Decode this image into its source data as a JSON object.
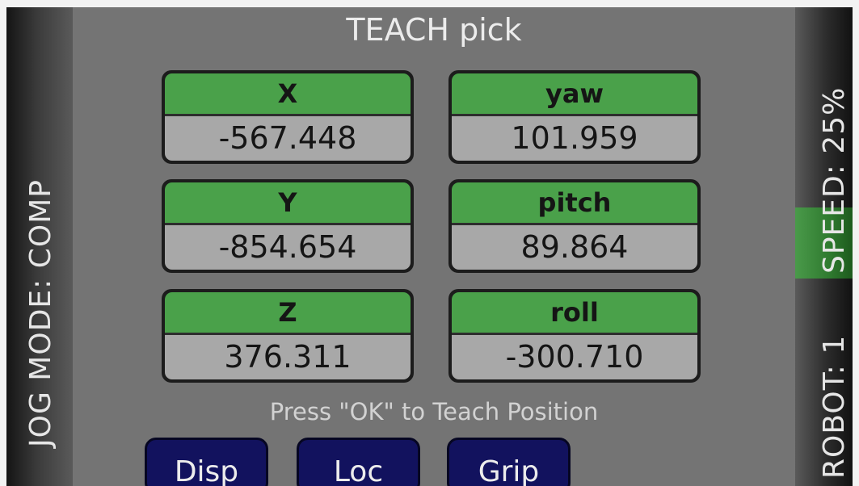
{
  "title": "TEACH pick",
  "jog_mode_label": "JOG MODE: COMP",
  "speed_label": "SPEED: 25%",
  "robot_label": "ROBOT: 1",
  "fields": {
    "x": {
      "label": "X",
      "value": "-567.448"
    },
    "yaw": {
      "label": "yaw",
      "value": "101.959"
    },
    "y": {
      "label": "Y",
      "value": "-854.654"
    },
    "pitch": {
      "label": "pitch",
      "value": "89.864"
    },
    "z": {
      "label": "Z",
      "value": "376.311"
    },
    "roll": {
      "label": "roll",
      "value": "-300.710"
    }
  },
  "hint": "Press \"OK\" to Teach Position",
  "buttons": {
    "disp": "Disp",
    "loc": "Loc",
    "grip": "Grip"
  },
  "colors": {
    "header_green": "#4aa14a",
    "button_navy": "#12125e",
    "background_gray": "#747474"
  }
}
